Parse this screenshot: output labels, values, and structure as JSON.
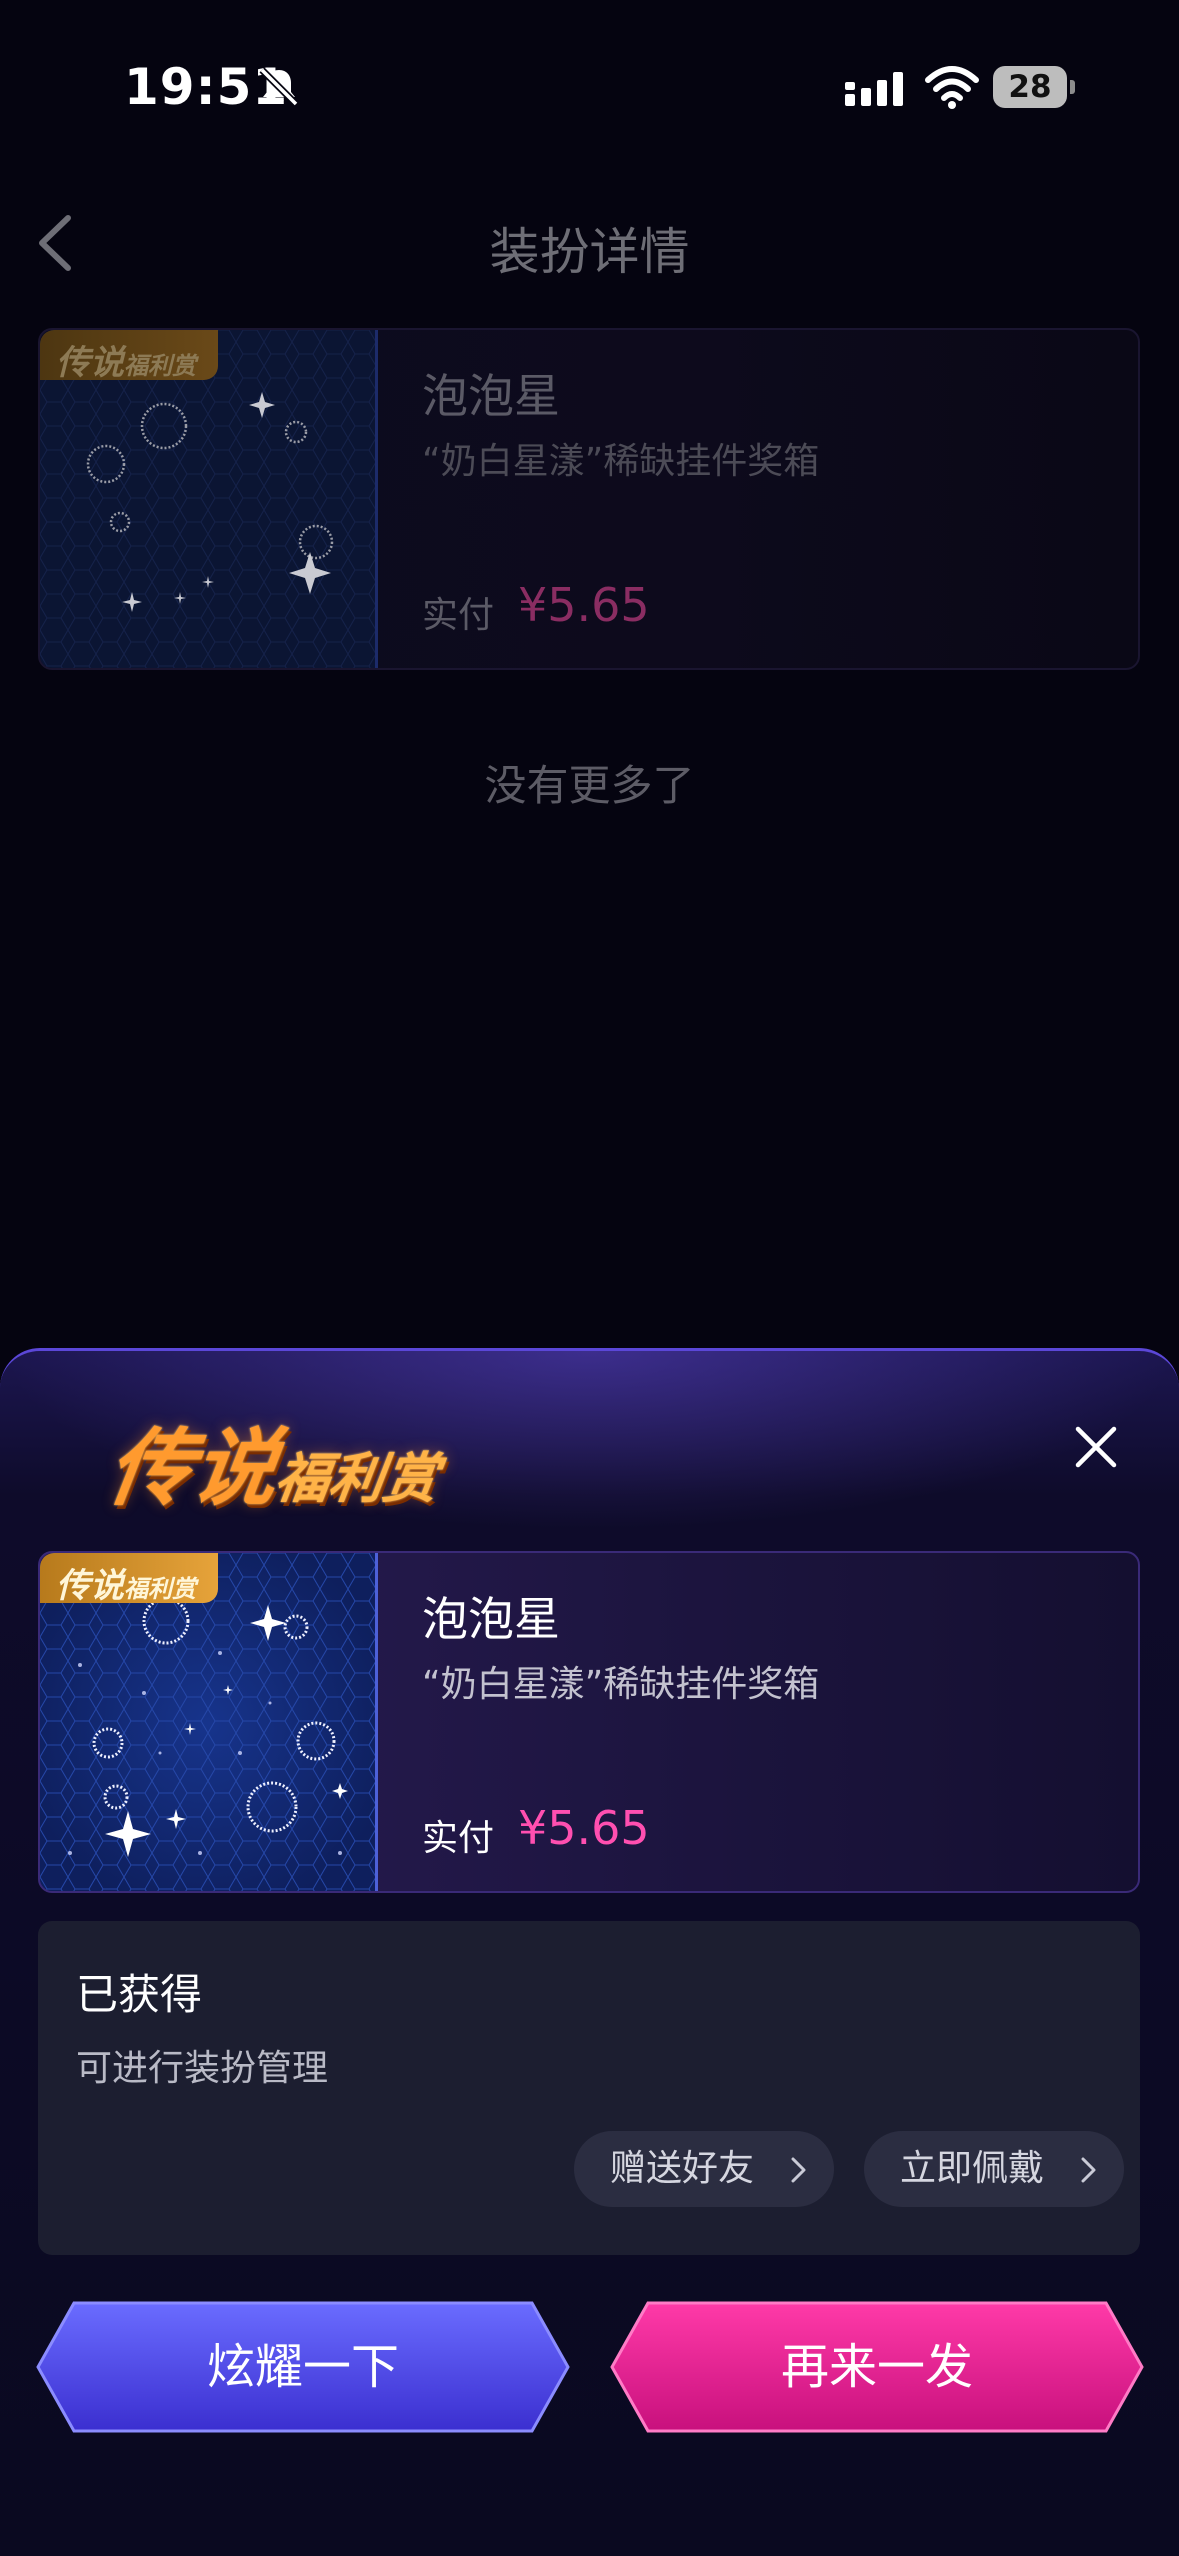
{
  "status_bar": {
    "time": "19:51",
    "battery": "28",
    "icons": [
      "bell-muted-icon",
      "signal-icon",
      "wifi-icon",
      "battery-icon"
    ]
  },
  "header": {
    "title": "装扮详情",
    "back_icon": "chevron-left-icon"
  },
  "background_card": {
    "tag": "传说",
    "tag_small": "福利赏",
    "name": "泡泡星",
    "subtitle": "“奶白星漾”稀缺挂件奖箱",
    "pay_label": "实付",
    "price": "¥5.65"
  },
  "list_end_text": "没有更多了",
  "sheet": {
    "logo_main": "传说",
    "logo_small": "福利赏",
    "close_icon": "close-icon",
    "card": {
      "tag": "传说",
      "tag_small": "福利赏",
      "name": "泡泡星",
      "subtitle": "“奶白星漾”稀缺挂件奖箱",
      "pay_label": "实付",
      "price": "¥5.65"
    },
    "obtained": {
      "title": "已获得",
      "description": "可进行装扮管理",
      "gift_button": "赠送好友",
      "wear_button": "立即佩戴"
    },
    "show_off_button": "炫耀一下",
    "again_button": "再来一发"
  },
  "colors": {
    "accent_pink": "#ff4fb0",
    "button_blue": "#4b45e6",
    "button_pink": "#e6168f",
    "tag_gold": "#e6a33a"
  }
}
